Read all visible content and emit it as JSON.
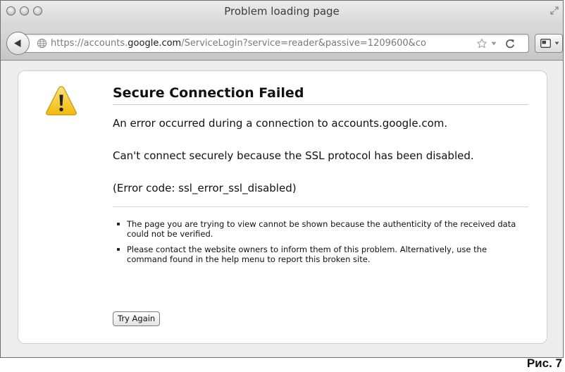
{
  "window": {
    "title": "Problem loading page"
  },
  "toolbar": {
    "url_prefix": "https://accounts.",
    "url_domain": "google.com",
    "url_path": "/ServiceLogin?service=reader&passive=1209600&co"
  },
  "error": {
    "title": "Secure Connection Failed",
    "paragraphs": [
      "An error occurred during a connection to accounts.google.com.",
      "Can't connect securely because the SSL protocol has been disabled.",
      "(Error code: ssl_error_ssl_disabled)"
    ],
    "bullets": [
      "The page you are trying to view cannot be shown because the authenticity of the received data could not be verified.",
      "Please contact the website owners to inform them of this problem. Alternatively, use the command found in the help menu to report this broken site."
    ],
    "button_label": "Try Again"
  },
  "figure": {
    "caption": "Рис. 7"
  },
  "icons": {
    "window_buttons": [
      "close-icon",
      "minimize-icon",
      "zoom-icon"
    ],
    "warning": "warning-triangle-icon",
    "globe": "globe-icon",
    "bookmark": "bookmark-star-icon",
    "reload": "reload-icon"
  },
  "colors": {
    "warning_fill": "#f5c21a",
    "warning_mark": "#222222",
    "content_background": "#ededed",
    "card_background": "#ffffff"
  }
}
